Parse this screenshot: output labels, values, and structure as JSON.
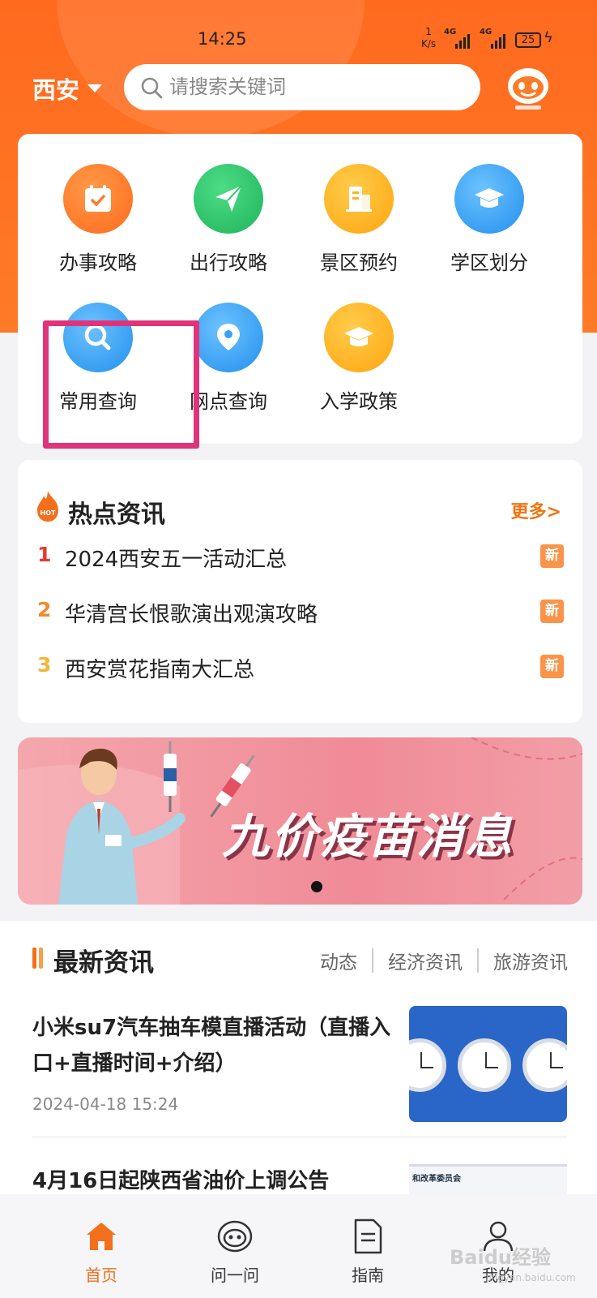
{
  "status_bar": {
    "time": "14:25",
    "net_speed_top": "1",
    "net_speed_unit": "K/s",
    "battery": "25",
    "signal_label": "4G"
  },
  "header": {
    "city": "西安",
    "search_placeholder": "请搜索关键词",
    "assistant_icon": "robot-assistant-icon"
  },
  "quick_services": [
    {
      "label": "办事攻略",
      "icon": "calendar-check-icon",
      "color": "#ff7a2a"
    },
    {
      "label": "出行攻略",
      "icon": "paper-plane-icon",
      "color": "#2ec46a"
    },
    {
      "label": "景区预约",
      "icon": "building-icon",
      "color": "#ffb11f"
    },
    {
      "label": "学区划分",
      "icon": "graduation-cap-icon",
      "color": "#37a2f5"
    },
    {
      "label": "常用查询",
      "icon": "search-icon",
      "color": "#37a2f5"
    },
    {
      "label": "网点查询",
      "icon": "location-pin-icon",
      "color": "#37a2f5"
    },
    {
      "label": "入学政策",
      "icon": "graduation-cap-icon",
      "color": "#ffb11f"
    }
  ],
  "hot_news": {
    "title": "热点资讯",
    "more": "更多>",
    "items": [
      {
        "rank": "1",
        "text": "2024西安五一活动汇总",
        "badge": "新",
        "rank_color": "#e8392e"
      },
      {
        "rank": "2",
        "text": "华清宫长恨歌演出观演攻略",
        "badge": "新",
        "rank_color": "#f08a2c"
      },
      {
        "rank": "3",
        "text": "西安赏花指南大汇总",
        "badge": "新",
        "rank_color": "#f5b43a"
      }
    ]
  },
  "banner": {
    "text": "九价疫苗消息"
  },
  "latest_news": {
    "title": "最新资讯",
    "tabs": [
      "动态",
      "经济资讯",
      "旅游资讯"
    ],
    "articles": [
      {
        "title": "小米su7汽车抽车模直播活动（直播入口+直播时间+介绍）",
        "date": "2024-04-18 15:24"
      },
      {
        "title": "4月16日起陕西省油价上调公告",
        "thumb_text": "和改革委员会"
      }
    ]
  },
  "bottom_nav": [
    {
      "label": "首页",
      "icon": "home-icon",
      "active": true
    },
    {
      "label": "问一问",
      "icon": "robot-icon",
      "active": false
    },
    {
      "label": "指南",
      "icon": "document-icon",
      "active": false
    },
    {
      "label": "我的",
      "icon": "user-icon",
      "active": false
    }
  ],
  "watermark": {
    "text": "Baidu经验",
    "subtext": "jingyan.baidu.com"
  }
}
